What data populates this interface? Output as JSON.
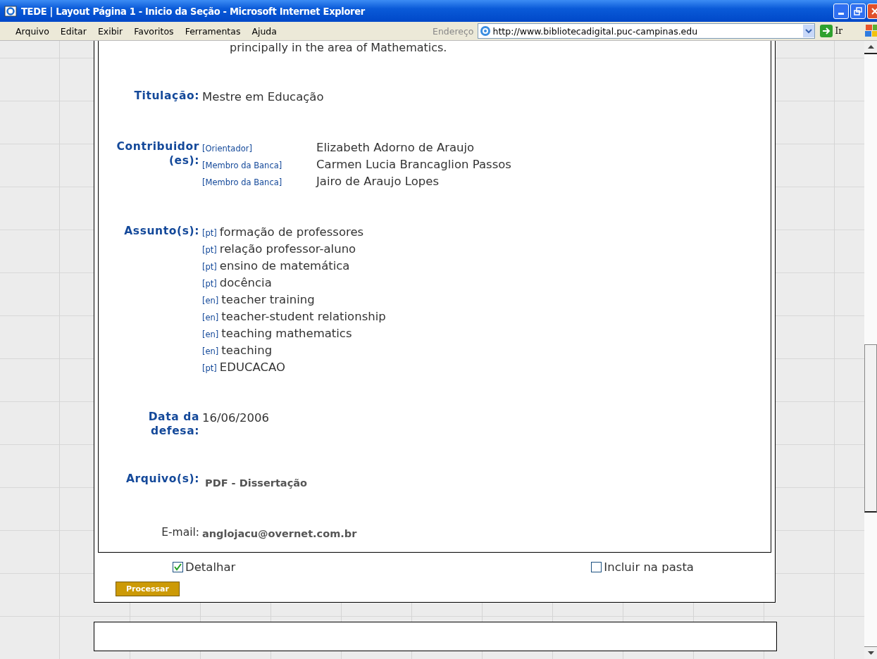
{
  "window": {
    "title": "TEDE | Layout Página 1 - Inicio da Seção - Microsoft Internet Explorer"
  },
  "menu": [
    "Arquivo",
    "Editar",
    "Exibir",
    "Favoritos",
    "Ferramentas",
    "Ajuda"
  ],
  "address_bar": {
    "label": "Endereço",
    "url": "http://www.bibliotecadigital.puc-campinas.edu",
    "go": "Ir"
  },
  "record": {
    "cut_text": "principally in the area of Mathematics.",
    "fields": [
      {
        "kind": "text",
        "label": "Titulação:",
        "value": "Mestre em Educação"
      },
      {
        "kind": "contributors",
        "label": "Contribuidor (es):",
        "items": [
          {
            "role": "[Orientador]",
            "name": "Elizabeth Adorno de Araujo"
          },
          {
            "role": "[Membro da Banca]",
            "name": "Carmen Lucia Brancaglion Passos"
          },
          {
            "role": "[Membro da Banca]",
            "name": "Jairo de Araujo Lopes"
          }
        ]
      },
      {
        "kind": "subjects",
        "label": "Assunto(s):",
        "items": [
          {
            "lang": "[pt]",
            "term": "formação de professores"
          },
          {
            "lang": "[pt]",
            "term": "relação professor-aluno"
          },
          {
            "lang": "[pt]",
            "term": "ensino de matemática"
          },
          {
            "lang": "[pt]",
            "term": "docência"
          },
          {
            "lang": "[en]",
            "term": "teacher training"
          },
          {
            "lang": "[en]",
            "term": "teacher-student relationship"
          },
          {
            "lang": "[en]",
            "term": "teaching mathematics"
          },
          {
            "lang": "[en]",
            "term": "teaching"
          },
          {
            "lang": "[pt]",
            "term": "EDUCACAO"
          }
        ]
      },
      {
        "kind": "text",
        "label": "Data da defesa:",
        "value": "16/06/2006"
      },
      {
        "kind": "file",
        "label": "Arquivo(s):",
        "value": "PDF - Dissertação"
      },
      {
        "kind": "email",
        "label": "E-mail:",
        "value": "anglojacu@overnet.com.br"
      }
    ]
  },
  "options": [
    {
      "label": "Detalhar",
      "checked": true
    },
    {
      "label": "Incluir na pasta",
      "checked": false
    }
  ],
  "button": "Processar"
}
